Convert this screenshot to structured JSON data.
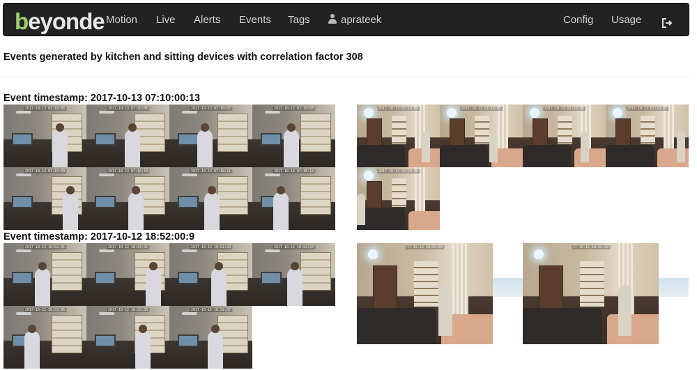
{
  "navbar": {
    "logo": "beyonde",
    "links": [
      "Motion",
      "Live",
      "Alerts",
      "Events",
      "Tags"
    ],
    "user": "aprateek",
    "right_links": [
      "Config",
      "Usage"
    ]
  },
  "page": {
    "heading": "Events generated by kitchen and sitting devices with correlation factor 308"
  },
  "events": [
    {
      "title": "Event timestamp: 2017-10-13 07:10:00:13",
      "kitchen_stamps": [
        "2017-10-13 07:10:05",
        "2017-10-13 07:10:06",
        "2017-10-13 07:10:07",
        "2017-10-13 07:10:08",
        "2017-10-13 07:10:09",
        "2017-10-13 07:10:10",
        "2017-10-13 07:10:11",
        "2017-10-13 07:10:12"
      ],
      "sitting_stamps": [
        "2017-10-13 07:10:04",
        "2017-10-13 07:10:05",
        "2017-10-13 07:10:06",
        "2017-10-13 07:10:07",
        "2017-10-13 07:10:08"
      ]
    },
    {
      "title": "Event timestamp: 2017-10-12 18:52:00:9",
      "kitchen_stamps": [
        "2017-10-12 18:52:01",
        "2017-10-12 18:52:02",
        "2017-10-12 18:52:03",
        "2017-10-12 18:52:04",
        "2017-10-12 18:52:05",
        "2017-10-12 18:52:06",
        "2017-10-12 18:52:07"
      ],
      "sitting_stamps": [
        "17-10-12 18:52:53",
        "17-10-12 18:52:32"
      ]
    }
  ]
}
